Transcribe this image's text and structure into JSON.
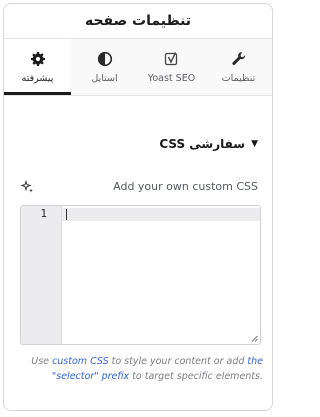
{
  "header": {
    "title": "تنظیمات صفحه"
  },
  "tabs": [
    {
      "label": "تنظیمات",
      "icon": "wrench-icon",
      "active": false
    },
    {
      "label": "Yoast SEO",
      "icon": "yoast-logo-icon",
      "active": false
    },
    {
      "label": "استایل",
      "icon": "half-circle-contrast-icon",
      "active": false
    },
    {
      "label": "پیشرفته",
      "icon": "gear-icon",
      "active": true
    }
  ],
  "section": {
    "title": "CSS سفارشی",
    "expanded": true
  },
  "css_field": {
    "label": "Add your own custom CSS",
    "ai_icon": "sparkle-icon",
    "line_number": "1",
    "value": ""
  },
  "help": {
    "prefix": "Use ",
    "link1": "custom CSS",
    "middle": " to style your content or add ",
    "link2": "the \"selector\" prefix",
    "suffix": " to target specific elements."
  },
  "colors": {
    "accent_link": "#3165d6",
    "active_tab": "#1b1b1b"
  }
}
